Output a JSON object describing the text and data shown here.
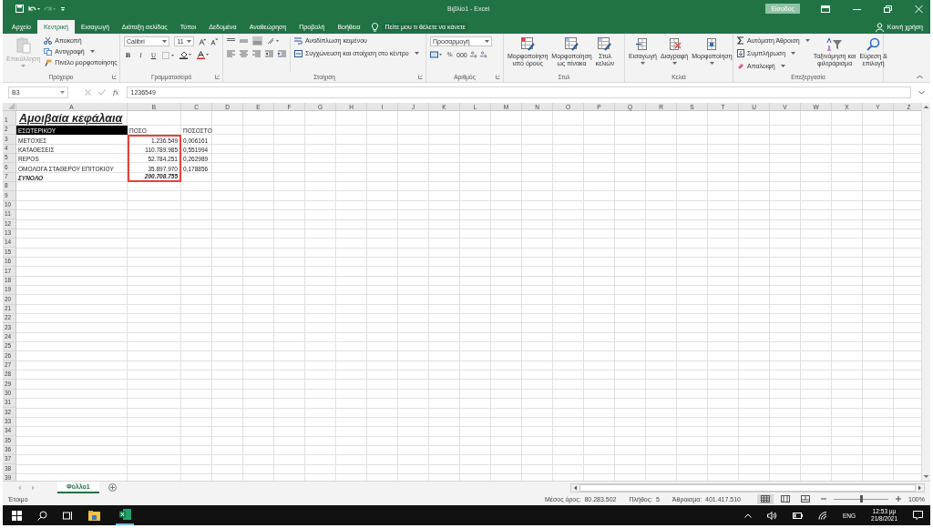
{
  "window": {
    "title": "Βιβλίο1 - Excel",
    "sign_in": "Είσοδος"
  },
  "tabs": [
    {
      "label": "Αρχείο",
      "selected": false
    },
    {
      "label": "Κεντρική",
      "selected": true
    },
    {
      "label": "Εισαγωγή",
      "selected": false
    },
    {
      "label": "Διάταξη σελίδας",
      "selected": false
    },
    {
      "label": "Τύποι",
      "selected": false
    },
    {
      "label": "Δεδομένα",
      "selected": false
    },
    {
      "label": "Αναθεώρηση",
      "selected": false
    },
    {
      "label": "Προβολή",
      "selected": false
    },
    {
      "label": "Βοήθεια",
      "selected": false
    }
  ],
  "tell_me": "Πείτε μου τι θέλετε να κάνετε",
  "share": "Κοινή χρήση",
  "ribbon": {
    "clipboard": {
      "label": "Πρόχειρο",
      "paste": "Επικόλληση",
      "cut": "Αποκοπή",
      "copy": "Αντιγραφή",
      "format_painter": "Πινέλο μορφοποίησης"
    },
    "font": {
      "label": "Γραμματοσειρά",
      "font_name": "Calibri",
      "font_size": "11",
      "bold": "B",
      "italic": "I",
      "underline": "U"
    },
    "alignment": {
      "label": "Στοίχιση",
      "wrap": "Αναδίπλωση κειμένου",
      "merge": "Συγχώνευση και στοίχιση στο κέντρο"
    },
    "number": {
      "label": "Αριθμός",
      "format": "Προσαρμογή",
      "percent": "%",
      "thousands": "000"
    },
    "styles": {
      "label": "Στυλ",
      "buttons": [
        {
          "lines": [
            "Μορφοποίηση",
            "υπό όρους"
          ]
        },
        {
          "lines": [
            "Μορφοποίηση",
            "ως πίνακα"
          ]
        },
        {
          "lines": [
            "Στυλ",
            "κελιών"
          ]
        }
      ]
    },
    "cells": {
      "label": "Κελιά",
      "buttons": [
        "Εισαγωγή",
        "Διαγραφή",
        "Μορφοποίηση"
      ]
    },
    "editing": {
      "label": "Επεξεργασία",
      "autosum": "Αυτόματη Άθροιση",
      "fill": "Συμπλήρωση",
      "clear": "Απαλοιφή",
      "sort": [
        "Ταξινόμηση και",
        "φιλτράρισμα"
      ],
      "find": [
        "Εύρεση &",
        "επιλογή"
      ]
    }
  },
  "formula_bar": {
    "name_box": "B3",
    "function_button": "fx",
    "formula": "1236549"
  },
  "columns": [
    "A",
    "B",
    "C",
    "D",
    "E",
    "F",
    "G",
    "H",
    "I",
    "J",
    "K",
    "L",
    "M",
    "N",
    "O",
    "P",
    "Q",
    "R",
    "S",
    "T",
    "U",
    "V",
    "W",
    "X",
    "Y",
    "Z"
  ],
  "rows": [
    {
      "number": "1",
      "cells": [
        {
          "text": "Αμοιβαία κεφάλαια",
          "kind": "title",
          "boxed": false
        }
      ]
    },
    {
      "number": "2",
      "cells": [
        {
          "text": "ΕΣΩΤΕΡΙΚΟΥ",
          "kind": "dark",
          "boxed": false
        },
        {
          "text": "ΠΟΣΟ",
          "kind": "text",
          "boxed": false
        },
        {
          "text": "ΠΟΣΟΣΤΟ",
          "kind": "text",
          "boxed": false
        }
      ]
    },
    {
      "number": "3",
      "cells": [
        {
          "text": "ΜΕΤΟΧΕΣ",
          "kind": "text",
          "boxed": false
        },
        {
          "text": "1.236.549",
          "kind": "number",
          "boxed": true
        },
        {
          "text": "0,006161",
          "kind": "text",
          "boxed": false
        }
      ]
    },
    {
      "number": "4",
      "cells": [
        {
          "text": "ΚΑΤΑΘΕΣΕΙΣ",
          "kind": "text",
          "boxed": false
        },
        {
          "text": "110.789.985",
          "kind": "number",
          "boxed": true
        },
        {
          "text": "0,551994",
          "kind": "text",
          "boxed": false
        }
      ]
    },
    {
      "number": "5",
      "cells": [
        {
          "text": "REPOS",
          "kind": "text",
          "boxed": false
        },
        {
          "text": "52.784.251",
          "kind": "number",
          "boxed": true
        },
        {
          "text": "0,262989",
          "kind": "text",
          "boxed": false
        }
      ]
    },
    {
      "number": "6",
      "cells": [
        {
          "text": "ΟΜΟΛΟΓΑ ΣΤΑΘΕΡΟΥ ΕΠΙΤΟΚΙΟΥ",
          "kind": "text",
          "boxed": false
        },
        {
          "text": "35.897.970",
          "kind": "number",
          "boxed": true
        },
        {
          "text": "0,178856",
          "kind": "text",
          "boxed": false
        }
      ]
    },
    {
      "number": "7",
      "cells": [
        {
          "text": "ΣΥΝΟΛΟ",
          "kind": "total",
          "boxed": false
        },
        {
          "text": "200.708.755",
          "kind": "total_number",
          "boxed": true
        }
      ]
    },
    {
      "number": "8",
      "cells": []
    },
    {
      "number": "9",
      "cells": []
    },
    {
      "number": "10",
      "cells": []
    },
    {
      "number": "11",
      "cells": []
    },
    {
      "number": "12",
      "cells": []
    },
    {
      "number": "13",
      "cells": []
    },
    {
      "number": "14",
      "cells": []
    },
    {
      "number": "15",
      "cells": []
    },
    {
      "number": "16",
      "cells": []
    },
    {
      "number": "17",
      "cells": []
    },
    {
      "number": "18",
      "cells": []
    },
    {
      "number": "19",
      "cells": []
    },
    {
      "number": "20",
      "cells": []
    },
    {
      "number": "21",
      "cells": []
    },
    {
      "number": "22",
      "cells": []
    },
    {
      "number": "23",
      "cells": []
    },
    {
      "number": "24",
      "cells": []
    },
    {
      "number": "25",
      "cells": []
    },
    {
      "number": "26",
      "cells": []
    },
    {
      "number": "27",
      "cells": []
    },
    {
      "number": "28",
      "cells": []
    },
    {
      "number": "29",
      "cells": []
    },
    {
      "number": "30",
      "cells": []
    },
    {
      "number": "31",
      "cells": []
    },
    {
      "number": "32",
      "cells": []
    },
    {
      "number": "33",
      "cells": []
    },
    {
      "number": "34",
      "cells": []
    },
    {
      "number": "35",
      "cells": []
    },
    {
      "number": "36",
      "cells": []
    },
    {
      "number": "37",
      "cells": []
    },
    {
      "number": "38",
      "cells": []
    },
    {
      "number": "39",
      "cells": []
    }
  ],
  "sheets": [
    {
      "label": "Φύλλο1",
      "selected": true
    }
  ],
  "status_bar": {
    "state": "Έτοιμο",
    "stats": [
      {
        "label": "Μέσος όρος:",
        "value": "80.283.502"
      },
      {
        "label": "Πλήθος:",
        "value": "5"
      },
      {
        "label": "Άθροισμα:",
        "value": "401.417.510"
      }
    ],
    "views": [
      {
        "kind": "normal",
        "selected": true
      },
      {
        "kind": "page_layout",
        "selected": false
      },
      {
        "kind": "page_break",
        "selected": false
      }
    ],
    "zoom": {
      "level": 0.5,
      "reading": "100%"
    }
  },
  "taskbar": {
    "language": "ENG",
    "time": "12:53 μμ",
    "date": "21/8/2021"
  }
}
